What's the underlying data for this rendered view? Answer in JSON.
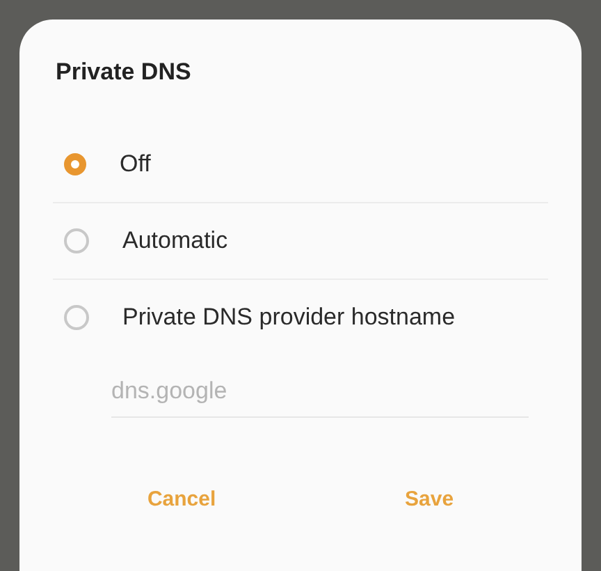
{
  "dialog": {
    "title": "Private DNS",
    "options": [
      {
        "label": "Off",
        "selected": true
      },
      {
        "label": "Automatic",
        "selected": false
      },
      {
        "label": "Private DNS provider hostname",
        "selected": false
      }
    ],
    "hostname_field": {
      "placeholder": "dns.google"
    },
    "buttons": [
      "Cancel",
      "Save"
    ]
  }
}
